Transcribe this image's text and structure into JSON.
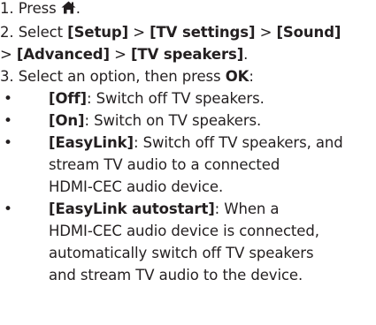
{
  "heading_fragment": "",
  "steps": {
    "s1": {
      "prefix": "1. Press",
      "suffix": "."
    },
    "s2a": {
      "prefix": "2. Select ",
      "setup": "[Setup]",
      "gt1": " > ",
      "tv": "[TV settings]",
      "gt2": " > ",
      "sound": "[Sound]"
    },
    "s2b": {
      "gt0": "> ",
      "advanced": "[Advanced]",
      "gt1": " > ",
      "speakers": "[TV speakers]",
      "end": "."
    },
    "s3": {
      "prefix": "3. Select an option, then press ",
      "ok": "OK",
      "colon": ":"
    }
  },
  "options": [
    {
      "bullet": "•",
      "label": "[Off]",
      "text": ": Switch off TV speakers."
    },
    {
      "bullet": "•",
      "label": "[On]",
      "text": ": Switch on TV speakers."
    },
    {
      "bullet": "•",
      "label": "[EasyLink]",
      "text": ": Switch off TV speakers, and",
      "cont": [
        "stream TV audio to a connected",
        "HDMI-CEC audio device."
      ]
    },
    {
      "bullet": "•",
      "label": "[EasyLink autostart]",
      "text": ": When a",
      "cont": [
        "HDMI-CEC audio device is connected,",
        "automatically switch off TV speakers",
        "and stream TV audio to the device."
      ]
    }
  ],
  "icons": {
    "home": "home-icon"
  }
}
